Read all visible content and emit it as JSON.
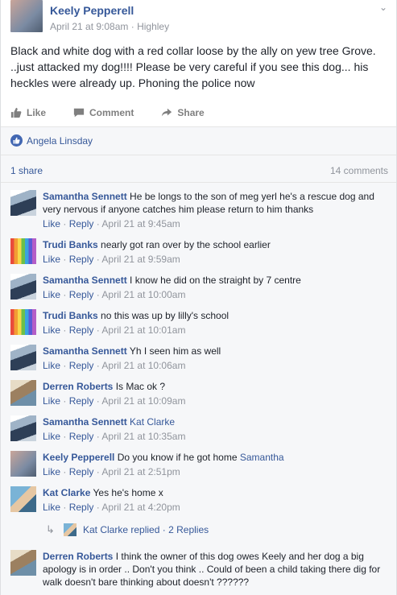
{
  "post": {
    "author": "Keely Pepperell",
    "date": "April 21 at 9:08am",
    "location": "Highley",
    "text": "Black and white dog with a red collar loose by the ally on yew tree Grove. ..just attacked my dog!!!! Please be very careful if you see this dog... his heckles were already up. Phoning the police now"
  },
  "actions": {
    "like": "Like",
    "comment": "Comment",
    "share": "Share"
  },
  "reactions": {
    "liker": "Angela Linsday"
  },
  "stats": {
    "shares": "1 share",
    "comments": "14 comments"
  },
  "comments": [
    {
      "name": "Samantha Sennett",
      "text": "He be longs to the son of meg yerl he's a rescue dog and very nervous if anyone catches him please return to him thanks",
      "time": "April 21 at 9:45am"
    },
    {
      "name": "Trudi Banks",
      "text": "nearly got ran over by the school earlier",
      "time": "April 21 at 9:59am"
    },
    {
      "name": "Samantha Sennett",
      "text": "I know he did on the straight by 7 centre",
      "time": "April 21 at 10:00am"
    },
    {
      "name": "Trudi Banks",
      "text": "no this was up by lilly's school",
      "time": "April 21 at 10:01am"
    },
    {
      "name": "Samantha Sennett",
      "text": "Yh I seen him as well",
      "time": "April 21 at 10:06am"
    },
    {
      "name": "Derren Roberts",
      "text": "Is Mac ok ?",
      "time": "April 21 at 10:09am"
    },
    {
      "name": "Samantha Sennett",
      "mention": "Kat Clarke",
      "time": "April 21 at 10:35am"
    },
    {
      "name": "Keely Pepperell",
      "text": "Do you know if he got home",
      "mention": "Samantha",
      "time": "April 21 at 2:51pm"
    },
    {
      "name": "Kat Clarke",
      "text": "Yes he's home x",
      "time": "April 21 at 4:20pm"
    },
    {
      "name": "Derren Roberts",
      "text": "I think the owner of this dog owes Keely and her dog a big apology is in order .. Don't you think .. Could of been a child taking there dig for walk doesn't bare thinking about doesn't ??????"
    }
  ],
  "comment_actions": {
    "like": "Like",
    "reply": "Reply"
  },
  "reply_summary": {
    "name": "Kat Clarke",
    "text": "replied",
    "count": "2 Replies"
  }
}
